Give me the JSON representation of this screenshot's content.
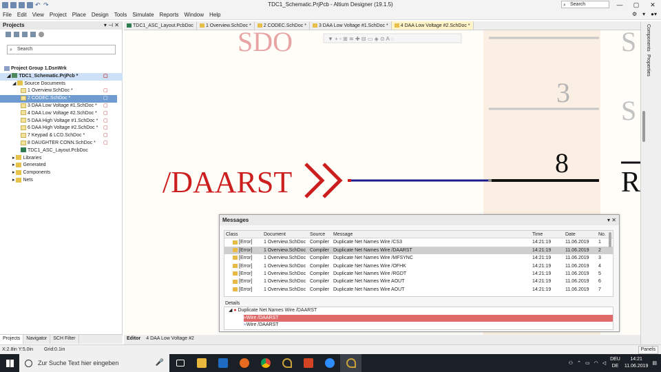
{
  "window": {
    "title": "TDC1_Schematic.PrjPcb - Altium Designer (19.1.5)",
    "search_placeholder": "Search"
  },
  "menu": [
    "File",
    "Edit",
    "View",
    "Project",
    "Place",
    "Design",
    "Tools",
    "Simulate",
    "Reports",
    "Window",
    "Help"
  ],
  "projects_panel": {
    "title": "Projects",
    "search_placeholder": "Search",
    "tree": [
      {
        "label": "Project Group 1.DsnWrk",
        "level": 0,
        "bold": true
      },
      {
        "label": "TDC1_Schematic.PrjPcb *",
        "level": 1,
        "bold": true,
        "selected": true,
        "mod": "▢"
      },
      {
        "label": "Source Documents",
        "level": 2
      },
      {
        "label": "1 Overview.SchDoc *",
        "level": 3,
        "mod": "▢"
      },
      {
        "label": "2 CODEC.SchDoc *",
        "level": 3,
        "highlight": true,
        "mod": "▢"
      },
      {
        "label": "3 DAA Low Voltage #1.SchDoc *",
        "level": 3,
        "mod": "▢"
      },
      {
        "label": "4 DAA Low Voltage #2.SchDoc *",
        "level": 3,
        "mod": "▢"
      },
      {
        "label": "5 DAA High Voltage #1.SchDoc *",
        "level": 3,
        "mod": "▢"
      },
      {
        "label": "6 DAA High Voltage #2.SchDoc *",
        "level": 3,
        "mod": "▢"
      },
      {
        "label": "7 Keypad & LCD.SchDoc *",
        "level": 3,
        "mod": "▢"
      },
      {
        "label": "8 DAUGHTER CONN.SchDoc *",
        "level": 3,
        "mod": "▢"
      },
      {
        "label": "TDC1_ASC_Layout.PcbDoc",
        "level": 3
      },
      {
        "label": "Libraries",
        "level": 1
      },
      {
        "label": "Generated",
        "level": 1
      },
      {
        "label": "Components",
        "level": 1
      },
      {
        "label": "Nets",
        "level": 1
      }
    ],
    "bottom_tabs": [
      "Projects",
      "Navigator",
      "SCH Filter"
    ]
  },
  "doc_tabs": [
    {
      "label": "TDC1_ASC_Layout.PcbDoc",
      "pcb": true
    },
    {
      "label": "1 Overview.SchDoc *"
    },
    {
      "label": "2 CODEC.SchDoc *"
    },
    {
      "label": "3 DAA Low Voltage #1.SchDoc *"
    },
    {
      "label": "4 DAA Low Voltage #2.SchDoc *",
      "active": true
    }
  ],
  "schematic": {
    "top_label": "SDO",
    "net_label": "/DAARST",
    "pin_3": "3",
    "pin_8": "8",
    "right_label_1": "S",
    "right_label_2": "S",
    "right_label_3": "R"
  },
  "right_panel_tabs": [
    "Components",
    "Properties"
  ],
  "messages": {
    "title": "Messages",
    "columns": [
      "Class",
      "Document",
      "Source",
      "Message",
      "Time",
      "Date",
      "No."
    ],
    "rows": [
      [
        "[Error]",
        "1 Overview.SchDoc",
        "Compiler",
        "Duplicate Net Names Wire /CS3",
        "14:21:19",
        "11.06.2019",
        "1"
      ],
      [
        "[Error]",
        "1 Overview.SchDoc",
        "Compiler",
        "Duplicate Net Names Wire /DAARST",
        "14:21:19",
        "11.06.2019",
        "2"
      ],
      [
        "[Error]",
        "1 Overview.SchDoc",
        "Compiler",
        "Duplicate Net Names Wire /MFSYNC",
        "14:21:19",
        "11.06.2019",
        "3"
      ],
      [
        "[Error]",
        "1 Overview.SchDoc",
        "Compiler",
        "Duplicate Net Names Wire /OFHK",
        "14:21:19",
        "11.06.2019",
        "4"
      ],
      [
        "[Error]",
        "1 Overview.SchDoc",
        "Compiler",
        "Duplicate Net Names Wire /RGDT",
        "14:21:19",
        "11.06.2019",
        "5"
      ],
      [
        "[Error]",
        "1 Overview.SchDoc",
        "Compiler",
        "Duplicate Net Names Wire AOUT",
        "14:21:19",
        "11.06.2019",
        "6"
      ],
      [
        "[Error]",
        "1 Overview.SchDoc",
        "Compiler",
        "Duplicate Net Names Wire AOUT",
        "14:21:19",
        "11.06.2019",
        "7"
      ]
    ],
    "selected_row": 1,
    "details_label": "Details",
    "details": {
      "header": "Duplicate Net Names Wire /DAARST",
      "items": [
        "Wire /DAARST",
        "Wire /DAARST"
      ]
    }
  },
  "editor_tabs": [
    "Editor",
    "4 DAA Low Voltage #2"
  ],
  "status": {
    "coords": "X:2.8in Y:5.0in",
    "grid": "Grid:0.1in",
    "panels": "Panels"
  },
  "taskbar": {
    "search_placeholder": "Zur Suche Text hier eingeben",
    "lang_1": "DEU",
    "lang_2": "DE",
    "time": "14:21",
    "date": "11.06.2019"
  },
  "colors": {
    "wire_blue": "#1a1a8c",
    "net_red": "#cc1e1e",
    "error_highlight": "#e06a6a"
  }
}
